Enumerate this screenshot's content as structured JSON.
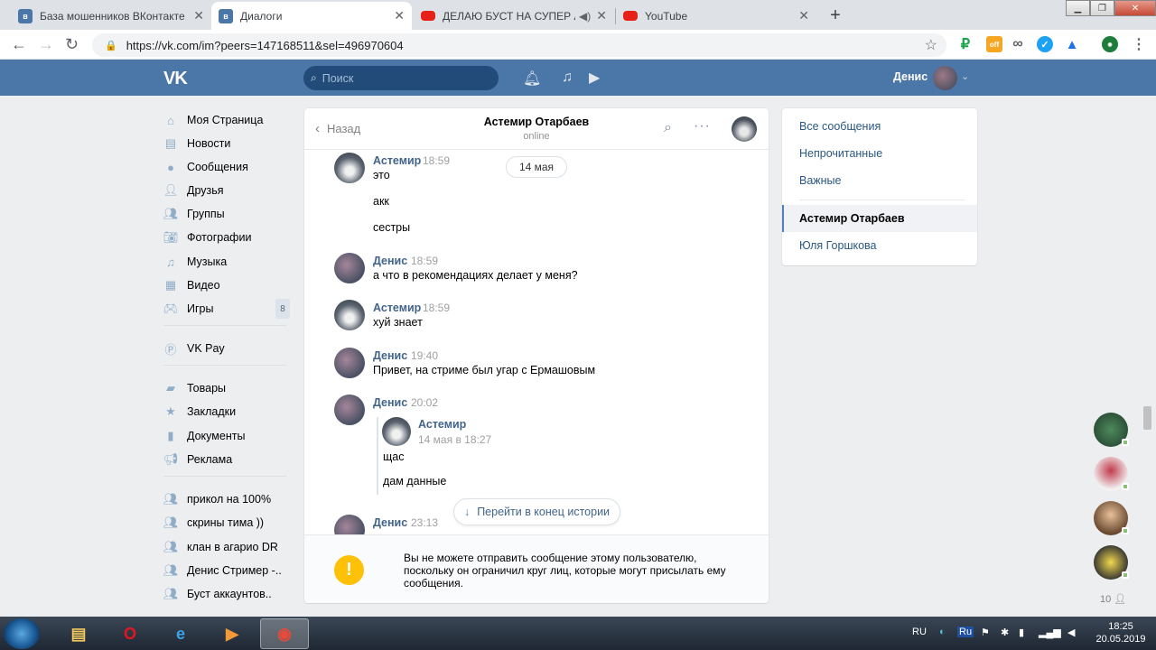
{
  "browser": {
    "tabs": [
      {
        "title": "База мошенников ВКонтакте Ки",
        "active": false,
        "favicon": "vk"
      },
      {
        "title": "Диалоги",
        "active": true,
        "favicon": "vk"
      },
      {
        "title": "ДЕЛАЮ БУСТ НА СУПЕР АКК",
        "active": false,
        "favicon": "youtube"
      },
      {
        "title": "YouTube",
        "active": false,
        "favicon": "youtube"
      }
    ],
    "url": "https://vk.com/im?peers=147168511&sel=496970604",
    "extensions": [
      {
        "icon": "ruble-icon",
        "color": "#1aa34a"
      },
      {
        "icon": "off-badge-icon",
        "color": "#f5a623",
        "label": "off"
      },
      {
        "icon": "infinity-icon",
        "color": "#5f6368"
      },
      {
        "icon": "check-shield-icon",
        "color": "#1da1f2"
      },
      {
        "icon": "triangle-a-icon",
        "color": "#1a73e8"
      }
    ]
  },
  "vk": {
    "logo": "VK",
    "search_placeholder": "Поиск",
    "user_name": "Денис",
    "accent": "#4a76a8"
  },
  "menu": {
    "items": [
      {
        "label": "Моя Страница",
        "icon": "home-icon"
      },
      {
        "label": "Новости",
        "icon": "news-icon"
      },
      {
        "label": "Сообщения",
        "icon": "messages-icon"
      },
      {
        "label": "Друзья",
        "icon": "friends-icon"
      },
      {
        "label": "Группы",
        "icon": "groups-icon"
      },
      {
        "label": "Фотографии",
        "icon": "camera-icon"
      },
      {
        "label": "Музыка",
        "icon": "music-icon"
      },
      {
        "label": "Видео",
        "icon": "video-icon"
      },
      {
        "label": "Игры",
        "icon": "games-icon",
        "count": "8"
      }
    ],
    "pay": {
      "label": "VK Pay",
      "icon": "vkpay-icon"
    },
    "extra": [
      {
        "label": "Товары",
        "icon": "bag-icon"
      },
      {
        "label": "Закладки",
        "icon": "star-icon"
      },
      {
        "label": "Документы",
        "icon": "document-icon"
      },
      {
        "label": "Реклама",
        "icon": "megaphone-icon"
      }
    ],
    "chats": [
      {
        "label": "прикол на 100%"
      },
      {
        "label": "скрины тима ))"
      },
      {
        "label": "клан в агарио DR"
      },
      {
        "label": "Денис Стример -.."
      },
      {
        "label": "Буст аккаунтов.."
      }
    ]
  },
  "chat": {
    "back_label": "Назад",
    "peer_name": "Астемир Отарбаев",
    "peer_status": "online",
    "date_pill": "14 мая",
    "messages": [
      {
        "author": "Астемир",
        "time": "18:59",
        "lines": [
          "это",
          "акк",
          "сестры"
        ]
      },
      {
        "author": "Денис",
        "time": "18:59",
        "lines": [
          "а что в рекомендациях делает у меня?"
        ]
      },
      {
        "author": "Астемир",
        "time": "18:59",
        "lines": [
          "хуй знает"
        ]
      },
      {
        "author": "Денис",
        "time": "19:40",
        "lines": [
          "Привет, на стриме был угар с Ермашовым"
        ]
      },
      {
        "author": "Денис",
        "time": "20:02",
        "lines": []
      },
      {
        "author": "Денис",
        "time": "23:13",
        "lines": []
      }
    ],
    "forwarded": {
      "author": "Астемир",
      "time": "14 мая в 18:27",
      "lines": [
        "щас",
        "дам данные"
      ]
    },
    "goto_end": "Перейти в конец истории",
    "warning": "Вы не можете отправить сообщение этому пользователю, поскольку он ограничил круг лиц, которые могут присылать ему сообщения."
  },
  "right": {
    "filters": [
      "Все сообщения",
      "Непрочитанные",
      "Важные"
    ],
    "dialogs": [
      {
        "name": "Астемир Отарбаев",
        "selected": true
      },
      {
        "name": "Юля Горшкова",
        "selected": false
      }
    ],
    "friends_online_count": "10"
  },
  "taskbar": {
    "lang": "RU",
    "time": "18:25",
    "date": "20.05.2019"
  }
}
